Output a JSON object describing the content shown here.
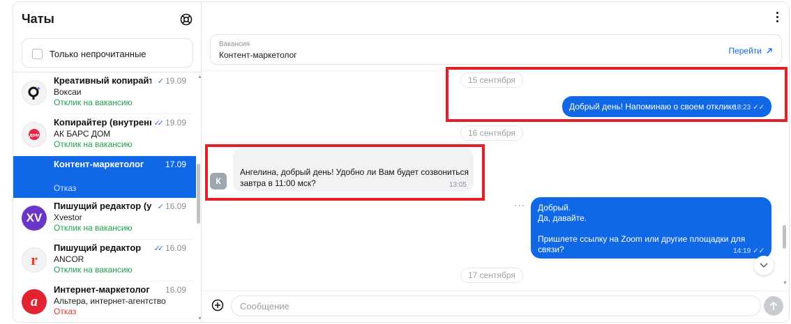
{
  "sidebar": {
    "title": "Чаты",
    "unread_filter_label": "Только непрочитанные",
    "chats": [
      {
        "title": "Креативный копирайтер",
        "date": "19.09",
        "company": "Воксаи",
        "status": "Отклик на вакансию",
        "status_type": "ok",
        "read": true,
        "avatar_color": "#f3f3f3",
        "avatar_fg": "#111111",
        "avatar_icon": "bubble-q-logo-icon"
      },
      {
        "title": "Копирайтер (внутренний)",
        "date": "19.09",
        "company": "АК БАРС ДОМ",
        "status": "Отклик на вакансию",
        "status_type": "ok",
        "read": true,
        "avatar_color": "#f3f3f3",
        "avatar_fg": "#e6264b",
        "avatar_icon": "akbars-logo-icon"
      },
      {
        "title": "Контент-маркетолог",
        "date": "17.09",
        "company": "",
        "status": "Отказ",
        "status_type": "no",
        "read": false,
        "active": true,
        "avatar_color": "#1068e6",
        "avatar_fg": "#1068e6",
        "avatar_icon": "blank-avatar"
      },
      {
        "title": "Пишущий редактор (удалённо)",
        "date": "16.09",
        "company": "Xvestor",
        "status": "Отклик на вакансию",
        "status_type": "ok",
        "read": true,
        "avatar_color": "#6b35c9",
        "avatar_fg": "#ffffff",
        "avatar_icon": "xv-logo-icon"
      },
      {
        "title": "Пишущий редактор",
        "date": "16.09",
        "company": "ANCOR",
        "status": "Отклик на вакансию",
        "status_type": "ok",
        "read": true,
        "avatar_color": "#f3f3f3",
        "avatar_fg": "#e8412c",
        "avatar_icon": "ancor-logo-icon"
      },
      {
        "title": "Интернет-маркетолог",
        "date": "16.09",
        "company": "Альтера, интернет-агентство",
        "status": "Отказ",
        "status_type": "no",
        "read": false,
        "avatar_color": "#e42332",
        "avatar_fg": "#ffffff",
        "avatar_icon": "altera-logo-icon"
      }
    ]
  },
  "vacancy": {
    "label": "Вакансия",
    "title": "Контент-маркетолог",
    "go_label": "Перейти"
  },
  "messages": {
    "date1": "15 сентября",
    "out1_text": "Добрый день! Напоминаю о своем отклике",
    "out1_time": "18:23",
    "date2": "16 сентября",
    "in1_avatar": "К",
    "in1_line1": "Ангелина, добрый день! Удобно ли Вам будет созвониться",
    "in1_line2": "завтра в 11:00 мск?",
    "in1_time": "13:05",
    "out2_line1": "Добрый.",
    "out2_line2": "Да, давайте.",
    "out2_line3": "Пришлете ссылку на Zoom или другие площадки для",
    "out2_line4": "связи?",
    "out2_time": "14:19",
    "date3": "17 сентября"
  },
  "composer": {
    "placeholder": "Сообщение"
  },
  "colors": {
    "accent": "#1068e6",
    "success": "#1aa34a",
    "danger": "#e0352b",
    "annotation": "#e3202a"
  }
}
